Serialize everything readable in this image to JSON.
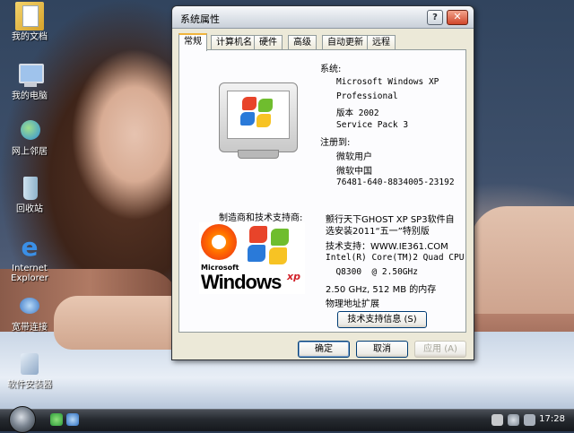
{
  "desktop": {
    "icons": [
      {
        "label": "我的文档",
        "icon": "my-documents-icon"
      },
      {
        "label": "我的电脑",
        "icon": "my-computer-icon"
      },
      {
        "label": "网上邻居",
        "icon": "network-places-icon"
      },
      {
        "label": "回收站",
        "icon": "recycle-bin-icon"
      },
      {
        "label": "Internet Explorer",
        "icon": "internet-explorer-icon"
      },
      {
        "label": "宽带连接",
        "icon": "broadband-connection-icon"
      },
      {
        "label": "软件安装器",
        "icon": "software-installer-icon"
      }
    ]
  },
  "window": {
    "title": "系统属性",
    "help_glyph": "?",
    "close_glyph": "✕",
    "tabs": [
      "常规",
      "计算机名",
      "硬件",
      "高级",
      "自动更新",
      "远程"
    ],
    "active_tab": 0,
    "system": {
      "heading": "系统:",
      "lines": [
        "Microsoft Windows XP",
        "Professional",
        "版本 2002",
        "Service Pack 3"
      ]
    },
    "registered": {
      "heading": "注册到:",
      "lines": [
        "微软用户",
        "微软中国",
        "76481-640-8834005-23192"
      ]
    },
    "manufacturer": {
      "heading": "制造商和技术支持商:",
      "logo_ms": "Microsoft",
      "logo_windows": "Windows",
      "logo_xp": "xp",
      "lines": [
        "颤行天下GHOST XP SP3软件自",
        "选安装2011“五一”特别版",
        "技术支持：WWW.IE361.COM",
        "Intel(R) Core(TM)2 Quad CPU",
        "  Q8300  @ 2.50GHz",
        "2.50 GHz, 512 MB 的内存",
        "物理地址扩展"
      ],
      "support_button": "技术支持信息 (S)"
    },
    "buttons": {
      "ok": "确定",
      "cancel": "取消",
      "apply": "应用 (A)"
    }
  },
  "taskbar": {
    "clock": "17:28"
  },
  "colors": {
    "dialog_bg": "#ece9d8",
    "flag_red": "#e8442a",
    "flag_green": "#6fbd2e",
    "flag_blue": "#2a7ad9",
    "flag_yellow": "#f7c324"
  }
}
